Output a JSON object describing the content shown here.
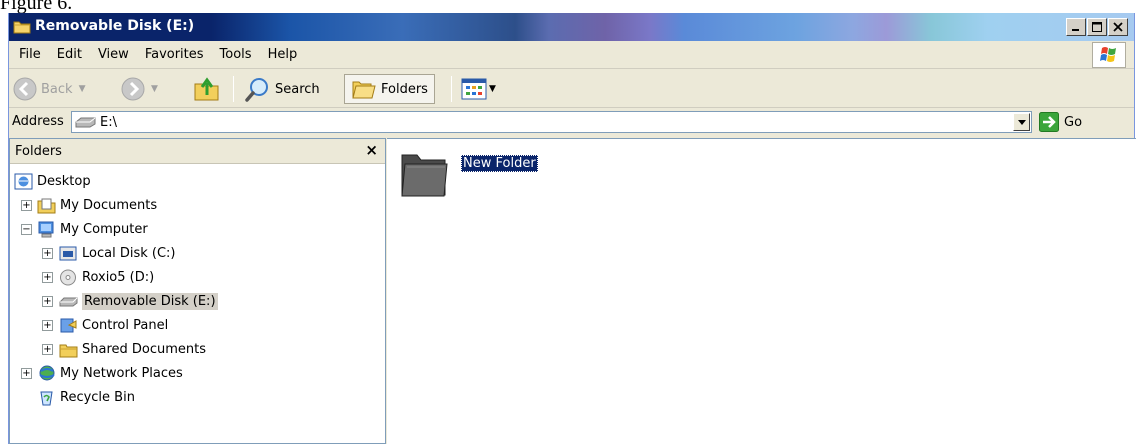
{
  "caption": "Figure 6.",
  "window": {
    "title": "Removable Disk (E:)"
  },
  "menu": [
    "File",
    "Edit",
    "View",
    "Favorites",
    "Tools",
    "Help"
  ],
  "toolbar": {
    "back_label": "Back",
    "search_label": "Search",
    "folders_label": "Folders"
  },
  "address": {
    "label": "Address",
    "value": "E:\\",
    "go_label": "Go"
  },
  "folders_pane": {
    "title": "Folders",
    "close": "×",
    "tree": [
      {
        "label": "Desktop",
        "icon": "desktop-icon"
      },
      {
        "label": "My Documents",
        "icon": "my-documents-icon"
      },
      {
        "label": "My Computer",
        "icon": "my-computer-icon"
      },
      {
        "label": "Local Disk (C:)",
        "icon": "local-disk-icon"
      },
      {
        "label": "Roxio5 (D:)",
        "icon": "cd-drive-icon"
      },
      {
        "label": "Removable Disk (E:)",
        "icon": "removable-disk-icon",
        "selected": true
      },
      {
        "label": "Control Panel",
        "icon": "control-panel-icon"
      },
      {
        "label": "Shared Documents",
        "icon": "shared-documents-icon"
      },
      {
        "label": "My Network Places",
        "icon": "network-places-icon"
      },
      {
        "label": "Recycle Bin",
        "icon": "recycle-bin-icon"
      }
    ]
  },
  "content": {
    "items": [
      {
        "name": "New Folder",
        "icon": "folder-icon",
        "selected": true
      }
    ]
  },
  "colors": {
    "title_bar": "#0a246a",
    "selection": "#0a246a",
    "chrome": "#ece9d8"
  }
}
